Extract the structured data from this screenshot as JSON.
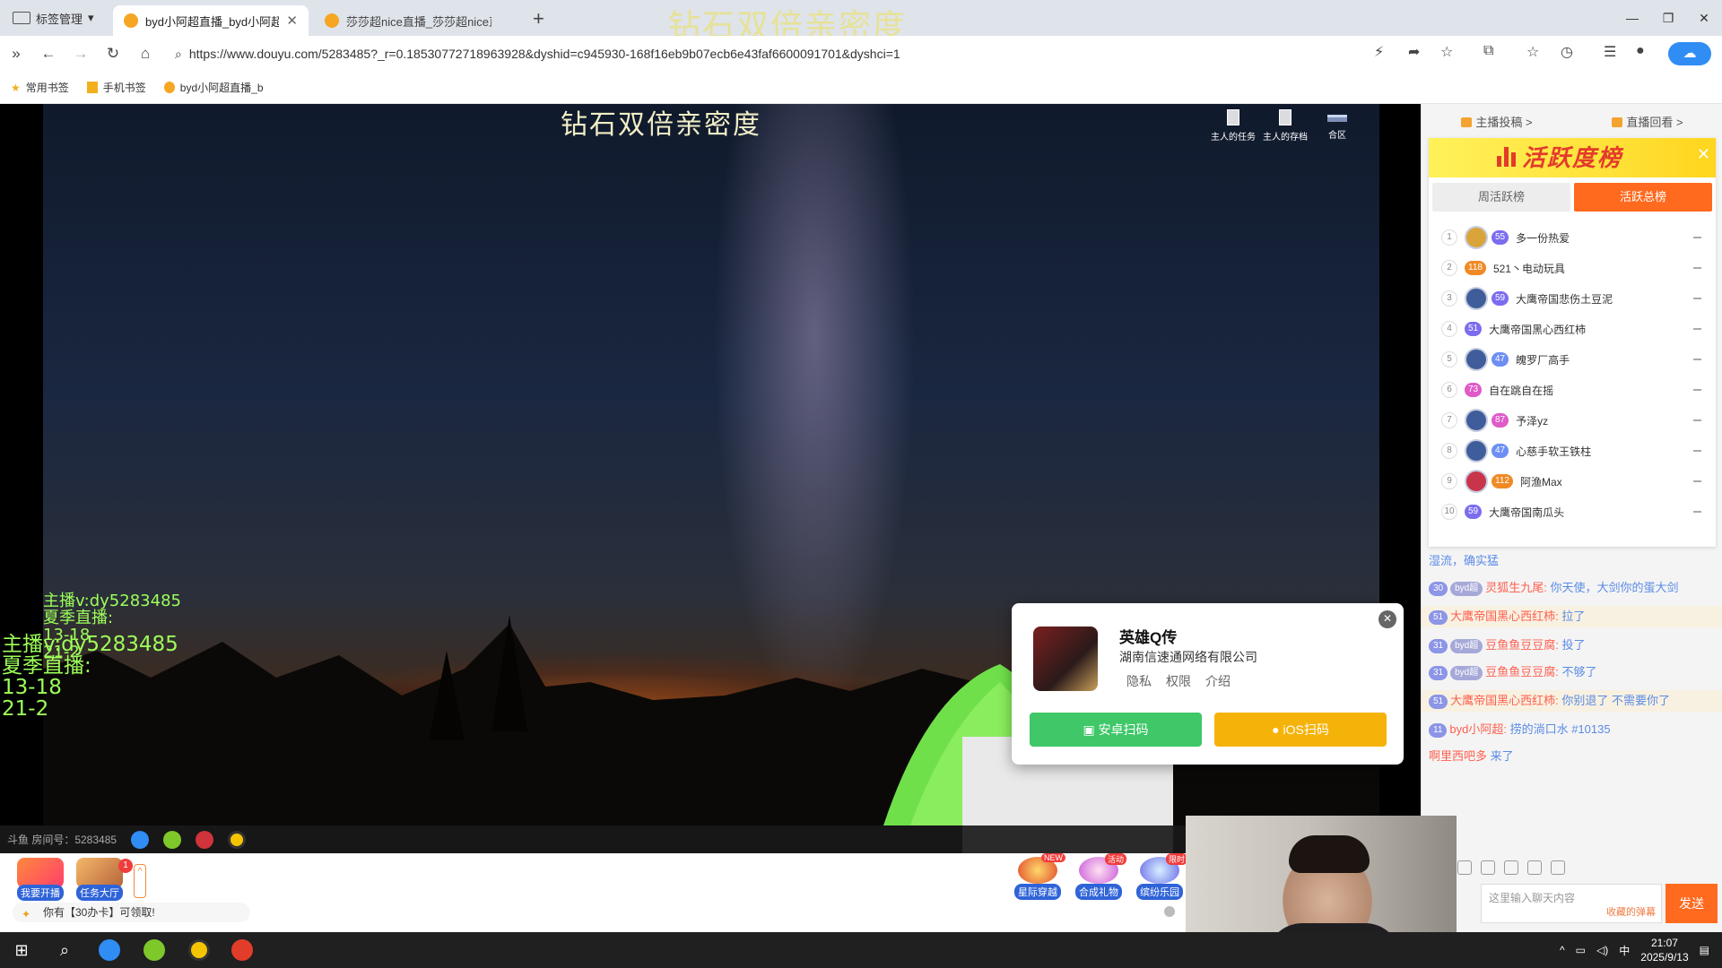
{
  "browser": {
    "tab_manager_label": "标签管理",
    "tabs": [
      {
        "title": "byd小阿超直播_byd小阿超直",
        "active": true
      },
      {
        "title": "莎莎超nice直播_莎莎超nice直播",
        "active": false
      }
    ],
    "url": "https://www.douyu.com/5283485?_r=0.18530772718963928&dyshid=c945930-168f16eb9b07ecb6e43faf6600091701&dyshci=1",
    "bookmarks": [
      "常用书签",
      "手机书签",
      "byd小阿超直播_b"
    ]
  },
  "overlay_title": "钻石双倍亲密度",
  "video": {
    "stream_title": "钻石双倍亲密度",
    "top_icons": [
      "主人的任务",
      "主人的存档",
      "合区"
    ],
    "green_small_lines": [
      "主播v:dy5283485",
      "夏季直播:",
      "13-18",
      "21-2"
    ],
    "green_big_lines": [
      "主播v:dy5283485",
      "夏季直播:",
      "13-18",
      "21-2"
    ],
    "strip_text": "斗鱼 房间号：5283485"
  },
  "popup": {
    "app_name": "英雄Q传",
    "company": "湖南信速通网络有限公司",
    "links": [
      "隐私",
      "权限",
      "介绍"
    ],
    "android_btn": "安卓扫码",
    "ios_btn": "iOS扫码"
  },
  "footer": {
    "btn_start": "我要开播",
    "btn_task": "任务大厅",
    "task_badge": "1",
    "reward": "你有【30办卡】可领取!",
    "activities": [
      {
        "label": "星际穿越",
        "tag": "NEW"
      },
      {
        "label": "合成礼物",
        "tag": "活动"
      },
      {
        "label": "缤纷乐园",
        "tag": "限时"
      }
    ]
  },
  "side": {
    "top_links": [
      "主播投稿 >",
      "直播回看 >"
    ],
    "rank_title": "活跃度榜",
    "tabs": [
      "周活跃榜",
      "活跃总榜"
    ],
    "rows": [
      {
        "n": "1",
        "lv": "55",
        "name": "多一份热爱",
        "lvcolor": "#7b6cf0",
        "crest": "#d9a53a"
      },
      {
        "n": "2",
        "lv": "118",
        "name": "521丶电动玩具",
        "lvcolor": "#f08a25",
        "crest": ""
      },
      {
        "n": "3",
        "lv": "59",
        "name": "大鹰帝国悲伤土豆泥",
        "lvcolor": "#7b6cf0",
        "crest": "#3f5d9a"
      },
      {
        "n": "4",
        "lv": "51",
        "name": "大鹰帝国黑心西红柿",
        "lvcolor": "#7b6cf0",
        "crest": ""
      },
      {
        "n": "5",
        "lv": "47",
        "name": "魄罗厂高手",
        "lvcolor": "#6d8ef5",
        "crest": "#3f5d9a"
      },
      {
        "n": "6",
        "lv": "73",
        "name": "自在跳自在摇",
        "lvcolor": "#e05ac8",
        "crest": ""
      },
      {
        "n": "7",
        "lv": "87",
        "name": "予泽yz",
        "lvcolor": "#e05ac8",
        "crest": "#3f5d9a"
      },
      {
        "n": "8",
        "lv": "47",
        "name": "心慈手软王铁柱",
        "lvcolor": "#6d8ef5",
        "crest": "#3f5d9a"
      },
      {
        "n": "9",
        "lv": "112",
        "name": "阿渔Max",
        "lvcolor": "#f08a25",
        "crest": "#c8354a"
      },
      {
        "n": "10",
        "lv": "59",
        "name": "大鹰帝国南瓜头",
        "lvcolor": "#7b6cf0",
        "crest": ""
      }
    ],
    "chat": [
      {
        "pill": "",
        "pill2": "",
        "user": "",
        "text": "湿流，确实猛",
        "hl": false
      },
      {
        "pill": "30",
        "pill2": "byd超",
        "user": "灵狐生九尾:",
        "text": "你天使，大剑你的蛋大剑",
        "hl": false
      },
      {
        "pill": "51",
        "pill2": "",
        "user": "大鹰帝国黑心西红柿:",
        "text": "拉了",
        "hl": true
      },
      {
        "pill": "31",
        "pill2": "byd超",
        "user": "豆鱼鱼豆豆腐:",
        "text": "投了",
        "hl": false
      },
      {
        "pill": "31",
        "pill2": "byd超",
        "user": "豆鱼鱼豆豆腐:",
        "text": "不够了",
        "hl": false
      },
      {
        "pill": "51",
        "pill2": "",
        "user": "大鹰帝国黑心西红柿:",
        "text": "你别退了 不需要你了",
        "hl": true
      },
      {
        "pill": "11",
        "pill2": "",
        "user": "byd小阿超:",
        "text": "捞的淌口水 #10135",
        "hl": false
      },
      {
        "pill": "",
        "pill2": "",
        "user": "啊里西吧多",
        "text": "来了",
        "hl": false
      }
    ],
    "input_placeholder": "这里输入聊天内容",
    "danmu_label": "收藏的弹幕",
    "send": "发送"
  },
  "taskbar": {
    "ime": "中",
    "time": "21:07",
    "date": "2025/9/13"
  }
}
